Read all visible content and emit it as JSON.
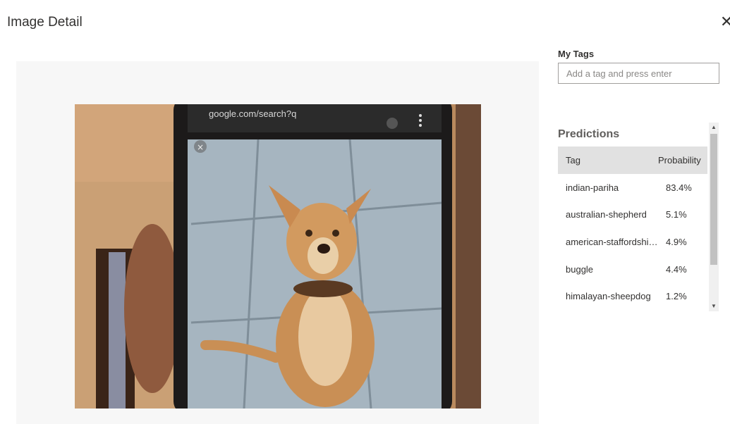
{
  "dialog": {
    "title": "Image Detail",
    "close_glyph": "✕"
  },
  "tags": {
    "label": "My Tags",
    "input_placeholder": "Add a tag and press enter",
    "input_value": ""
  },
  "predictions": {
    "title": "Predictions",
    "columns": {
      "tag": "Tag",
      "probability": "Probability"
    },
    "rows": [
      {
        "tag": "indian-pariha",
        "probability": "83.4%"
      },
      {
        "tag": "australian-shepherd",
        "probability": "5.1%"
      },
      {
        "tag": "american-staffordshire-…",
        "probability": "4.9%"
      },
      {
        "tag": "buggle",
        "probability": "4.4%"
      },
      {
        "tag": "himalayan-sheepdog",
        "probability": "1.2%"
      }
    ]
  },
  "photo": {
    "subject": "photo of a phone screen showing a tan dog sitting on a paved floor",
    "screen_url_text": "google.com/search?q"
  },
  "scrollbar": {
    "up_glyph": "▲",
    "down_glyph": "▼"
  }
}
